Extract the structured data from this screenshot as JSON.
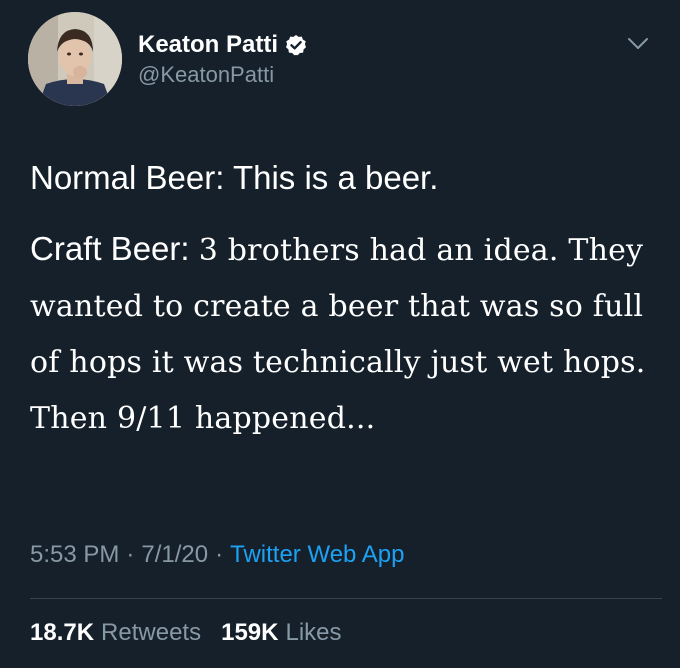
{
  "author": {
    "display_name": "Keaton Patti",
    "handle": "@KeatonPatti",
    "verified_icon": "verified-badge-icon",
    "avatar_icon": "profile-photo"
  },
  "menu_icon": "chevron-down-icon",
  "tweet": {
    "line1": "Normal Beer: This is a beer.",
    "line2_lead": "Craft Beer: ",
    "line2_rest": "3 brothers had an idea. They wanted to create a beer that was so full of hops it was technically just wet hops. Then 9/11 happened..."
  },
  "meta": {
    "time": "5:53 PM",
    "separator": "·",
    "date": "7/1/20",
    "source": "Twitter Web App"
  },
  "stats": {
    "retweets_count": "18.7K",
    "retweets_label": "Retweets",
    "likes_count": "159K",
    "likes_label": "Likes"
  },
  "colors": {
    "background": "#15202b",
    "secondary_text": "#8899a6",
    "link": "#1da1f2",
    "divider": "#38444d"
  }
}
